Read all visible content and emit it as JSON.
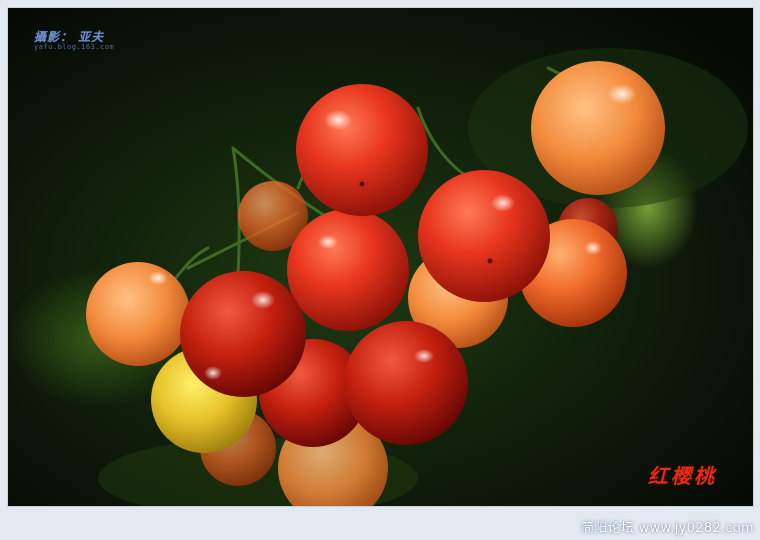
{
  "photo": {
    "credit": "攝影： 亚夫",
    "credit_url": "yafu.blog.163.com",
    "caption": "红樱桃",
    "subject": "cherries"
  },
  "footer": {
    "site": "简阳论坛 www.jy0282.com"
  },
  "colors": {
    "frame": "#e3e9f0",
    "caption": "#e62a16",
    "credit": "#6f8fc8"
  }
}
